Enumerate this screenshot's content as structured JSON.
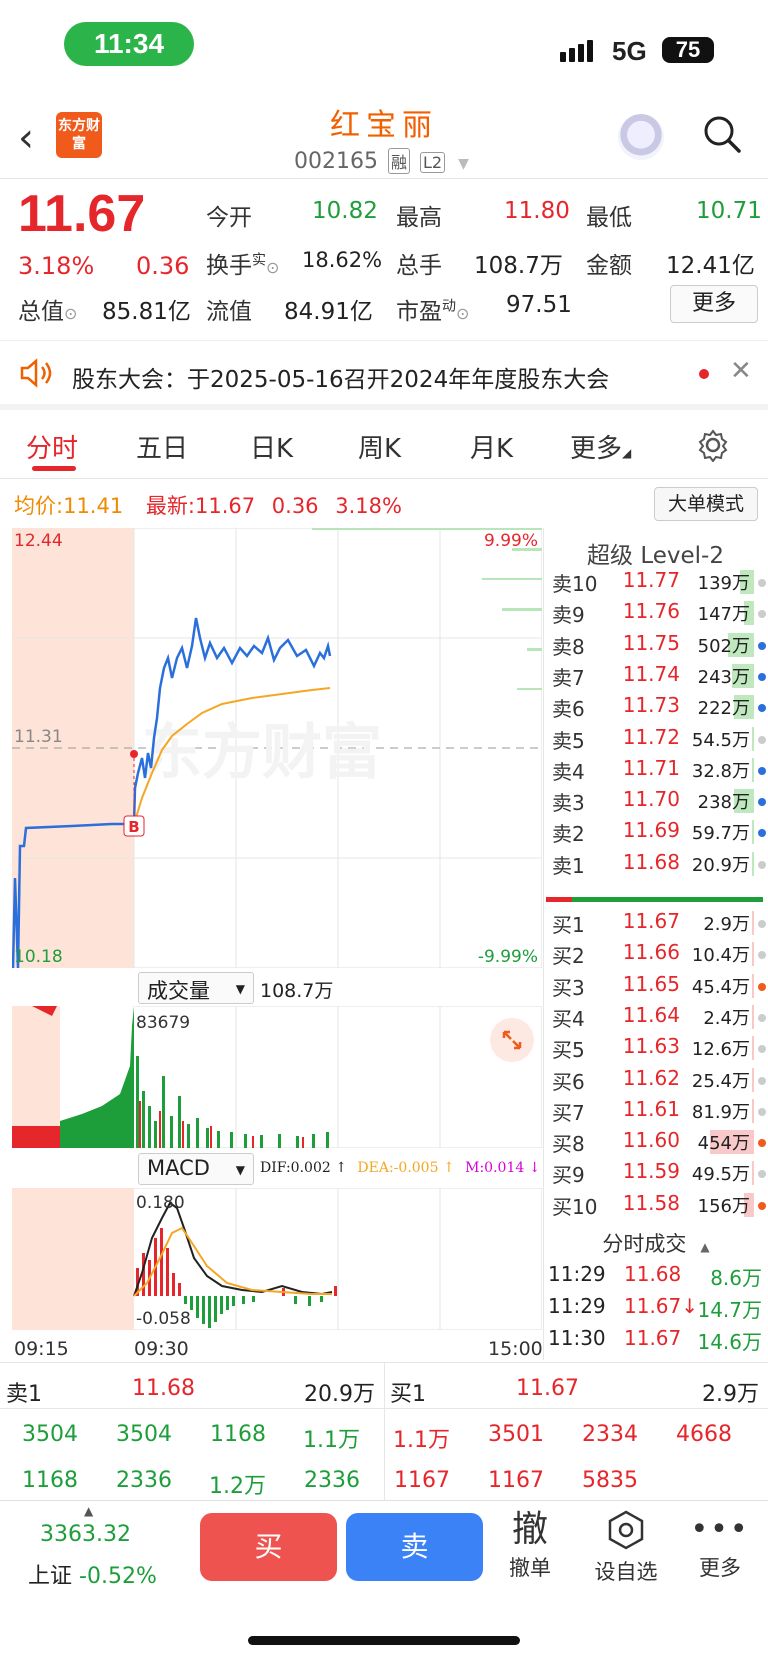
{
  "status": {
    "time": "11:34",
    "network": "5G",
    "battery": "75"
  },
  "header": {
    "logo_text": "东方财富",
    "stock_name": "红宝丽",
    "stock_code": "002165",
    "tag1": "融",
    "tag2": "L2"
  },
  "quote": {
    "price": "11.67",
    "pct": "3.18%",
    "change": "0.36",
    "open_label": "今开",
    "open": "10.82",
    "high_label": "最高",
    "high": "11.80",
    "low_label": "最低",
    "low": "10.71",
    "turnover_label": "换手",
    "turnover_sup": "实",
    "turnover": "18.62%",
    "volume_label": "总手",
    "volume": "108.7万",
    "amount_label": "金额",
    "amount": "12.41亿",
    "mktcap_label": "总值",
    "mktcap": "85.81亿",
    "float_label": "流值",
    "float": "84.91亿",
    "pe_label": "市盈",
    "pe_sup": "动",
    "pe": "97.51",
    "more": "更多"
  },
  "announcement": {
    "text": "股东大会：于2025-05-16召开2024年年度股东大会"
  },
  "tabs": [
    "分时",
    "五日",
    "日K",
    "周K",
    "月K",
    "更多"
  ],
  "info": {
    "avg_label": "均价:",
    "avg": "11.41",
    "latest_label": "最新:",
    "latest": "11.67",
    "chg": "0.36",
    "pct": "3.18%",
    "bigorder": "大单模式"
  },
  "chart": {
    "y_top": "12.44",
    "y_mid": "11.31",
    "y_bot": "10.18",
    "pct_top": "9.99%",
    "pct_bot": "-9.99%",
    "marker": "B",
    "watermark": "东方财富",
    "vol_label": "成交量",
    "vol_total": "108.7万",
    "vol_peak": "83679",
    "macd_label": "MACD",
    "dif": "DIF:0.002 ↑",
    "dea": "DEA:-0.005 ↑",
    "m": "M:0.014 ↓",
    "macd_top": "0.180",
    "macd_bot": "-0.058",
    "t_start": "09:15",
    "t_open": "09:30",
    "t_end": "15:00"
  },
  "orderbook": {
    "title": "超级 Level-2",
    "asks": [
      {
        "label": "卖10",
        "price": "11.77",
        "vol": "139万",
        "dot": "#ccc"
      },
      {
        "label": "卖9",
        "price": "11.76",
        "vol": "147万",
        "dot": "#ccc"
      },
      {
        "label": "卖8",
        "price": "11.75",
        "vol": "502万",
        "dot": "#2a6fdb"
      },
      {
        "label": "卖7",
        "price": "11.74",
        "vol": "243万",
        "dot": "#2a6fdb"
      },
      {
        "label": "卖6",
        "price": "11.73",
        "vol": "222万",
        "dot": "#2a6fdb"
      },
      {
        "label": "卖5",
        "price": "11.72",
        "vol": "54.5万",
        "dot": "#ccc"
      },
      {
        "label": "卖4",
        "price": "11.71",
        "vol": "32.8万",
        "dot": "#2a6fdb"
      },
      {
        "label": "卖3",
        "price": "11.70",
        "vol": "238万",
        "dot": "#2a6fdb"
      },
      {
        "label": "卖2",
        "price": "11.69",
        "vol": "59.7万",
        "dot": "#2a6fdb"
      },
      {
        "label": "卖1",
        "price": "11.68",
        "vol": "20.9万",
        "dot": "#ccc"
      }
    ],
    "bids": [
      {
        "label": "买1",
        "price": "11.67",
        "vol": "2.9万",
        "dot": "#ccc"
      },
      {
        "label": "买2",
        "price": "11.66",
        "vol": "10.4万",
        "dot": "#ccc"
      },
      {
        "label": "买3",
        "price": "11.65",
        "vol": "45.4万",
        "dot": "#f05a1a"
      },
      {
        "label": "买4",
        "price": "11.64",
        "vol": "2.4万",
        "dot": "#ccc"
      },
      {
        "label": "买5",
        "price": "11.63",
        "vol": "12.6万",
        "dot": "#ccc"
      },
      {
        "label": "买6",
        "price": "11.62",
        "vol": "25.4万",
        "dot": "#ccc"
      },
      {
        "label": "买7",
        "price": "11.61",
        "vol": "81.9万",
        "dot": "#ccc"
      },
      {
        "label": "买8",
        "price": "11.60",
        "vol": "454万",
        "dot": "#f05a1a"
      },
      {
        "label": "买9",
        "price": "11.59",
        "vol": "49.5万",
        "dot": "#ccc"
      },
      {
        "label": "买10",
        "price": "11.58",
        "vol": "156万",
        "dot": "#f05a1a"
      }
    ],
    "fenshi_title": "分时成交",
    "trades": [
      {
        "t": "11:29",
        "p": "11.68",
        "v": "8.6万"
      },
      {
        "t": "11:29",
        "p": "11.67↓",
        "v": "14.7万"
      },
      {
        "t": "11:30",
        "p": "11.67",
        "v": "14.6万"
      }
    ]
  },
  "queue": {
    "sell_label": "卖1",
    "sell_price": "11.68",
    "sell_total": "20.9万",
    "buy_label": "买1",
    "buy_price": "11.67",
    "buy_total": "2.9万",
    "sell_row1": [
      "3504",
      "3504",
      "1168",
      "1.1万"
    ],
    "sell_row2": [
      "1168",
      "2336",
      "1.2万",
      "2336"
    ],
    "buy_row1": [
      "1.1万",
      "3501",
      "2334",
      "4668"
    ],
    "buy_row2": [
      "1167",
      "1167",
      "5835"
    ]
  },
  "bottom": {
    "index_value": "3363.32",
    "index_name": "上证",
    "index_pct": "-0.52%",
    "buy": "买",
    "sell": "卖",
    "cancel_icon": "撤",
    "cancel": "撤单",
    "watch": "设自选",
    "more": "更多"
  }
}
